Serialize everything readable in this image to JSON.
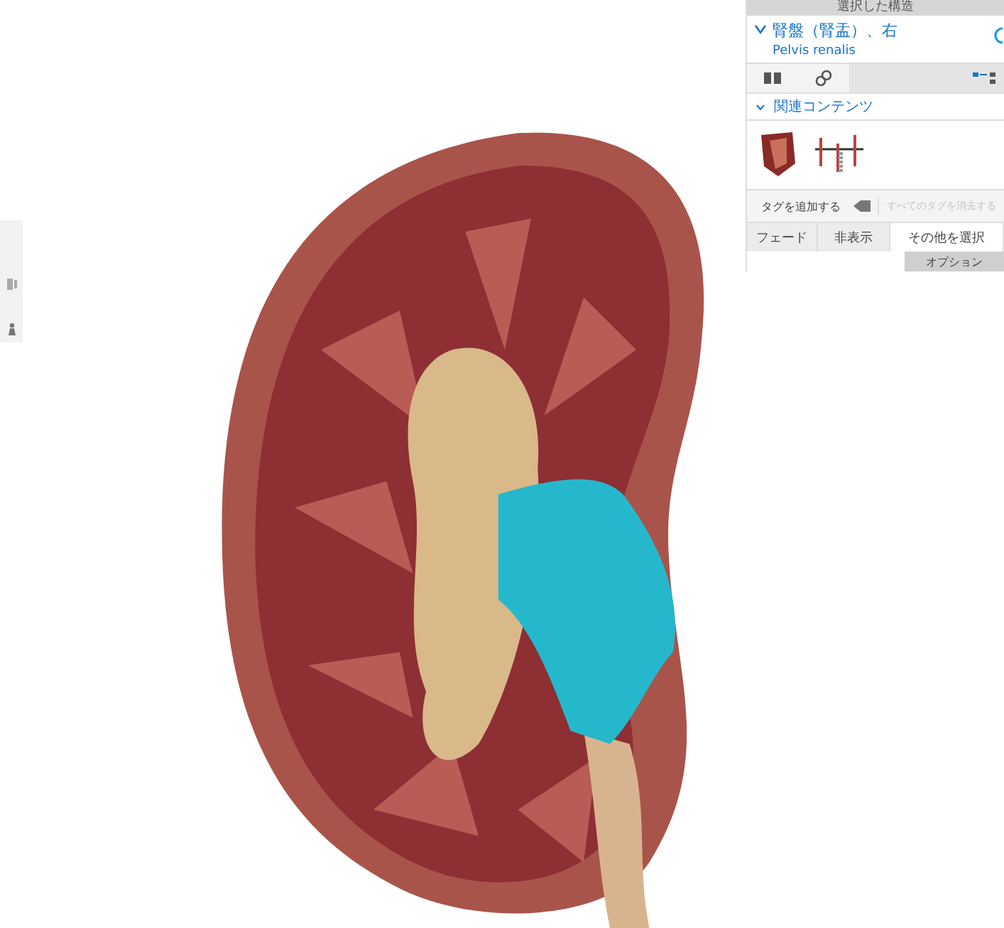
{
  "panel": {
    "header": "選択した構造",
    "structure": {
      "name": "腎盤（腎盂）、右",
      "latin": "Pelvis renalis"
    },
    "tabs": [
      {
        "kind": "book",
        "selected": false
      },
      {
        "kind": "link",
        "selected": false
      },
      {
        "kind": "layout",
        "selected": true
      }
    ],
    "related": {
      "title": "関連コンテンツ"
    },
    "tags": {
      "add_label": "タグを追加する",
      "clear_label": "すべてのタグを消去する",
      "clear_disabled": true
    },
    "actions": [
      {
        "label": "フェード",
        "selected": false
      },
      {
        "label": "非表示",
        "selected": false
      },
      {
        "label": "その他を選択",
        "selected": true
      }
    ],
    "options_tab": "オプション"
  }
}
